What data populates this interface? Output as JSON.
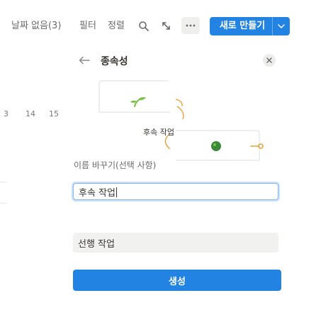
{
  "toolbar": {
    "items": [
      {
        "label": "날짜 없음(3)"
      },
      {
        "label": "필터"
      },
      {
        "label": "정렬"
      }
    ],
    "new_button_label": "새로 만들기"
  },
  "board": {
    "dates": [
      "3",
      "14",
      "15"
    ]
  },
  "panel": {
    "title": "종속성",
    "illustration_label": "후속 작업",
    "rename_label": "이름 바꾸기(선택 사항)",
    "rename_value": "후속 작업",
    "suggestion": "선행 작업",
    "create_label": "생성"
  },
  "colors": {
    "accent": "#2383e2",
    "sprout_green": "#7cc043",
    "chip_green": "#3a8a3a",
    "arrow_orange": "#e8a23a"
  },
  "icons": [
    "search-icon",
    "arrow-diagonal-icon",
    "more-icon",
    "chevron-down-icon",
    "back-arrow-icon",
    "close-icon",
    "sprout-icon",
    "dependency-link-icon"
  ]
}
